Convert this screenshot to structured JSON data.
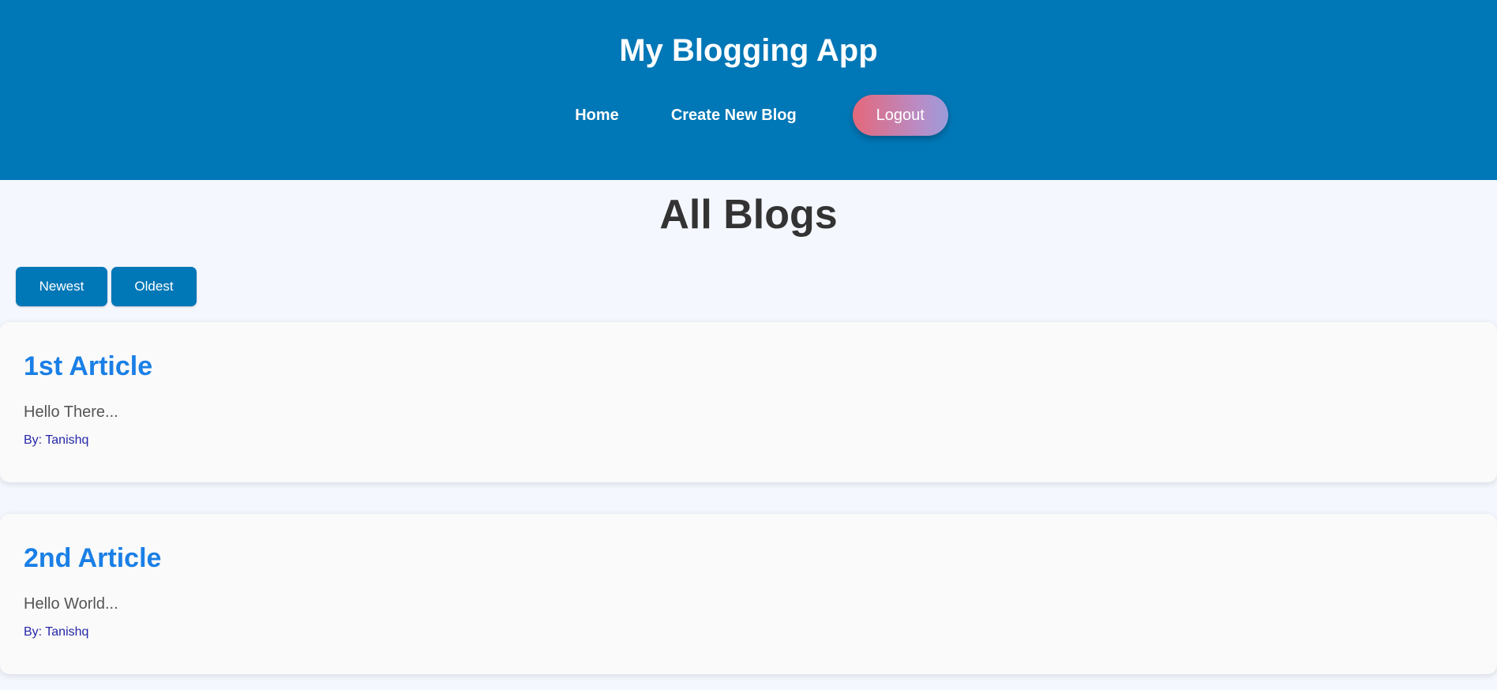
{
  "header": {
    "app_title": "My Blogging App",
    "nav": {
      "home_label": "Home",
      "create_label": "Create New Blog",
      "logout_label": "Logout"
    }
  },
  "main": {
    "page_title": "All Blogs",
    "sort": {
      "newest_label": "Newest",
      "oldest_label": "Oldest"
    },
    "blogs": [
      {
        "title": "1st Article",
        "excerpt": "Hello There...",
        "author": "By: Tanishq"
      },
      {
        "title": "2nd Article",
        "excerpt": "Hello World...",
        "author": "By: Tanishq"
      }
    ]
  },
  "colors": {
    "header_bg": "#0077b6",
    "page_bg": "#f4f7fe",
    "button_bg": "#0077b6",
    "blog_title": "#1a7fe6",
    "author_text": "#2626a8",
    "logout_gradient_start": "#e4687a",
    "logout_gradient_end": "#9b9cda"
  }
}
